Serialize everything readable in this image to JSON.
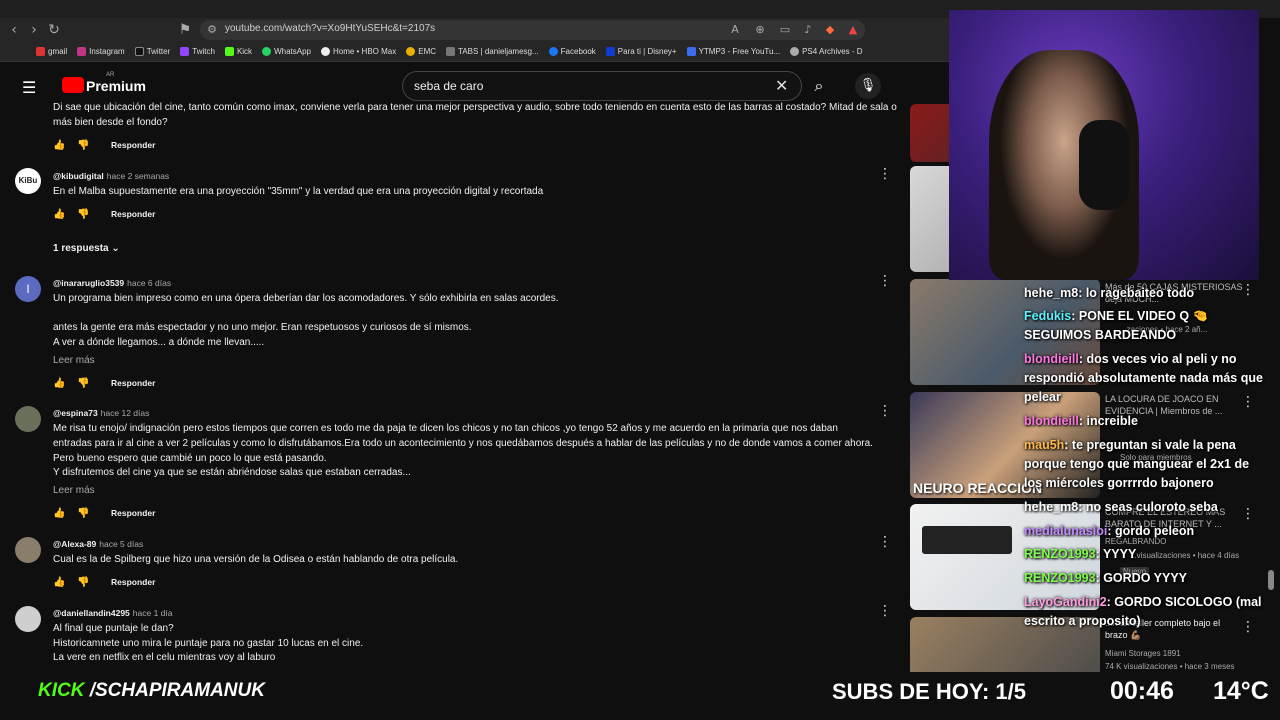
{
  "browser": {
    "url": "youtube.com/watch?v=Xo9HtYuSEHc&t=2107s",
    "bookmarks": [
      "gmail",
      "Instagram",
      "Twitter",
      "Twitch",
      "Kick",
      "WhatsApp",
      "Home • HBO Max",
      "EMC",
      "TABS | danieljamesg...",
      "Facebook",
      "Para ti | Disney+",
      "YTMP3 - Free YouTu...",
      "PS4 Archives - D"
    ]
  },
  "youtube": {
    "logo_text": "Premium",
    "logo_country": "AR",
    "search_value": "seba de caro"
  },
  "comments": [
    {
      "handle": "",
      "time": "",
      "text": "Di sae que ubicación del cine, tanto común como imax, conviene verla para tener una mejor perspectiva y audio, sobre todo teniendo en cuenta esto de las barras al costado? Mitad de sala o más bien desde el fondo?",
      "reply": "Responder"
    },
    {
      "handle": "@kibudigital",
      "time": "hace 2 semanas",
      "avatar_text": "KiBu",
      "text": "En el Malba supuestamente era una proyección \"35mm\" y la verdad que era una proyección digital y recortada",
      "reply": "Responder",
      "replies": "1 respuesta"
    },
    {
      "handle": "@inararuglio3539",
      "time": "hace 6 días",
      "avatar_text": "I",
      "text1": "Un programa bien impreso como en una ópera deberían dar los acomodadores. Y sólo exhibirla en salas acordes.",
      "text2": "antes la gente era más espectador y no uno mejor. Eran respetuosos y curiosos de sí mismos.",
      "text3": "A ver a dónde llegamos... a dónde me llevan.....",
      "more": "Leer más",
      "reply": "Responder"
    },
    {
      "handle": "@espina73",
      "time": "hace 12 días",
      "text1": "Me risa tu enojo/ indignación pero estos tiempos que corren es todo me da paja te dicen los chicos y no tan chicos ,yo tengo 52 años y me acuerdo en la primaria que nos daban",
      "text2": "entradas para ir al cine a ver 2 películas y como lo disfrutábamos.Era todo un acontecimiento y nos quedábamos después  a hablar de las películas y no de donde vamos a comer ahora.",
      "text3": "Pero bueno espero que cambié un poco lo que está pasando.",
      "text4": "Y disfrutemos del cine ya que se están abriéndose salas que estaban cerradas...",
      "more": "Leer más",
      "reply": "Responder"
    },
    {
      "handle": "@Alexa-89",
      "time": "hace 5 días",
      "text": "Cual es la de Spilberg que hizo una versión de la Odisea o están hablando de otra película.",
      "reply": "Responder"
    },
    {
      "handle": "@daniellandin4295",
      "time": "hace 1 día",
      "text1": "Al final que puntaje le dan?",
      "text2": "Historicamnete uno mira le puntaje para no gastar 10 lucas en el cine.",
      "text3": "La vere en netflix en el celu mientras voy al laburo",
      "reply": "Responder"
    }
  ],
  "sidebar": [
    {
      "title": "Más de 50 CAJAS MISTERIOSAS deja MUCH...",
      "meta": "...zaciones • hace 2 añ..."
    },
    {
      "title": "LA LOCURA DE JOACO EN EVIDENCIA | Miembros de ...",
      "meta": "Solo para miembros",
      "thumb_text": "NEURO REACCION"
    },
    {
      "title": "COMPRÉ EL ESTÉREO MÁS BARATO DE INTERNET Y ...",
      "meta": "REGALBRANDO",
      "meta2": "...visualizaciones • hace 4 días",
      "badge": "Nuevo"
    },
    {
      "title": "...n un taller completo bajo el brazo 💪🏽",
      "meta": "Miami Storages 1891",
      "meta2": "74 K visualizaciones • hace 3 meses"
    }
  ],
  "chat": [
    {
      "user": "hehe_m8",
      "color": "#ffffff",
      "msg": ": lo ragebaiteo todo"
    },
    {
      "user": "Fedukis",
      "color": "#5ef0ff",
      "msg": ": PONE EL VIDEO Q 🤏 SEGUIMOS BARDEANDO"
    },
    {
      "user": "blondieill",
      "color": "#ff77e0",
      "msg": ": dos veces vio al peli y no respondió absolutamente nada más que pelear"
    },
    {
      "user": "blondieill",
      "color": "#ff77e0",
      "msg": ": increible"
    },
    {
      "user": "mau5h",
      "color": "#ffb84a",
      "msg": ": te preguntan si vale la pena porque tengo que manguear el 2x1 de los miércoles gorrrrdo bajonero"
    },
    {
      "user": "hehe_m8",
      "color": "#ffffff",
      "msg": ": no seas culoroto seba"
    },
    {
      "user": "medialunasloi",
      "color": "#c48bff",
      "msg": ": gordo peleon"
    },
    {
      "user": "RENZO1993",
      "color": "#7cff4a",
      "msg": ": YYYY"
    },
    {
      "user": "RENZO1993",
      "color": "#7cff4a",
      "msg": ": GORDO YYYY"
    },
    {
      "user": "LayoGandini2",
      "color": "#ff9de0",
      "msg": ": GORDO SICOLOGO (mal escrito a proposito)"
    }
  ],
  "overlay": {
    "kick_brand": "KICK",
    "kick_channel": "/SCHAPIRAMANUK",
    "subs": "SUBS DE HOY: 1/5",
    "clock": "00:46",
    "temp": "14°C"
  },
  "colors": {
    "accent": "#ff0000",
    "kick_green": "#53fc18",
    "bg": "#0f0f0f"
  }
}
